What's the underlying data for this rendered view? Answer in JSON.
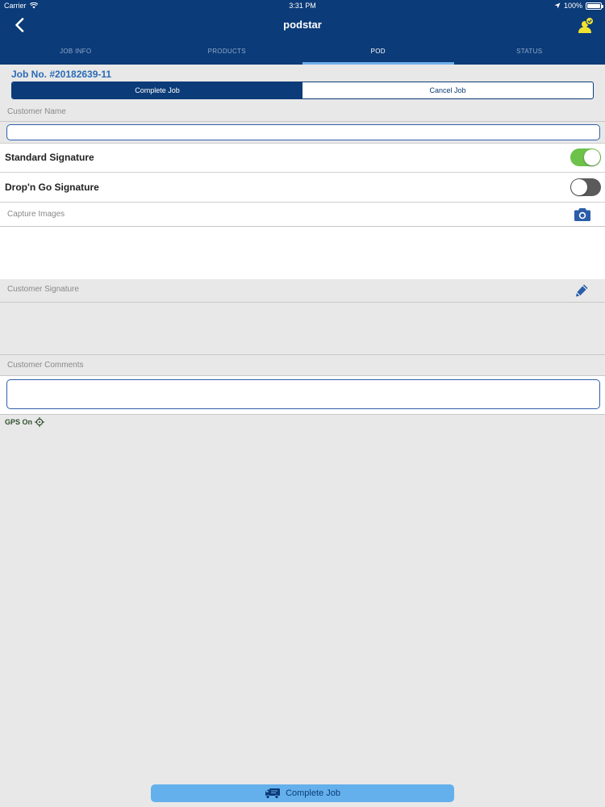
{
  "status_bar": {
    "carrier": "Carrier",
    "time": "3:31 PM",
    "battery": "100%"
  },
  "nav": {
    "title": "podstar",
    "back_icon": "chevron-left-icon",
    "user_icon": "driver-user-icon"
  },
  "tabs": [
    {
      "label": "JOB INFO",
      "active": false
    },
    {
      "label": "PRODUCTS",
      "active": false
    },
    {
      "label": "POD",
      "active": true
    },
    {
      "label": "STATUS",
      "active": false
    }
  ],
  "job": {
    "number": "Job No. #20182639-11",
    "actions": [
      {
        "label": "Complete Job",
        "active": true
      },
      {
        "label": "Cancel Job",
        "active": false
      }
    ]
  },
  "form": {
    "customer_name_label": "Customer Name",
    "customer_name_value": "",
    "standard_signature": {
      "label": "Standard Signature",
      "on": true
    },
    "dropngo_signature": {
      "label": "Drop'n Go Signature",
      "on": false
    },
    "capture_images_label": "Capture Images",
    "customer_signature_label": "Customer Signature",
    "customer_comments_label": "Customer Comments",
    "customer_comments_value": ""
  },
  "gps": {
    "label": "GPS On"
  },
  "footer": {
    "complete_label": "Complete Job"
  },
  "colors": {
    "nav_bg": "#0b3b78",
    "accent": "#2a6bb5",
    "toggle_on": "#6cc24a",
    "button_bg": "#64b0ec"
  }
}
